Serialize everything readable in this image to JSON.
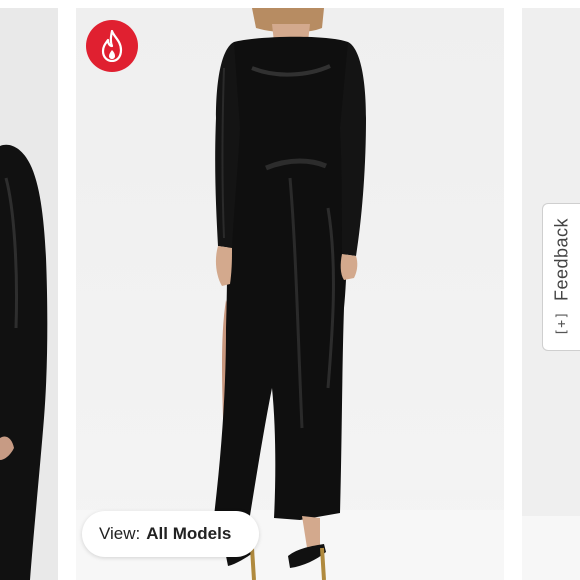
{
  "gallery": {
    "view_toggle": {
      "prefix": "View:",
      "value": "All Models"
    },
    "badge": {
      "icon": "flame-icon",
      "color": "#e02030"
    },
    "garment_color": "#0f0f0f"
  },
  "feedback": {
    "label": "Feedback",
    "icon": "plus-bracket-icon"
  }
}
